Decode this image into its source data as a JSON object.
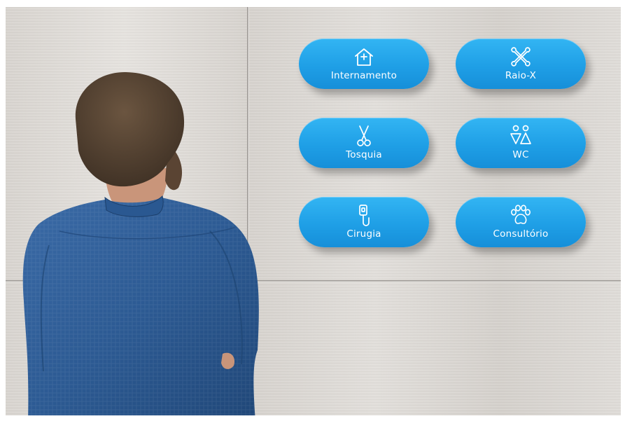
{
  "signs": {
    "internamento": {
      "label": "Internamento",
      "icon": "house-plus-icon"
    },
    "raiox": {
      "label": "Raio-X",
      "icon": "crossed-bones-icon"
    },
    "tosquia": {
      "label": "Tosquia",
      "icon": "scissors-icon"
    },
    "wc": {
      "label": "WC",
      "icon": "restroom-icon"
    },
    "cirugia": {
      "label": "Cirugia",
      "icon": "iv-bag-icon"
    },
    "consultorio": {
      "label": "Consultório",
      "icon": "paw-icon"
    }
  },
  "colors": {
    "sign_blue": "#1f9fe6",
    "wall": "#dcd8d4",
    "shirt": "#2d5c96"
  }
}
